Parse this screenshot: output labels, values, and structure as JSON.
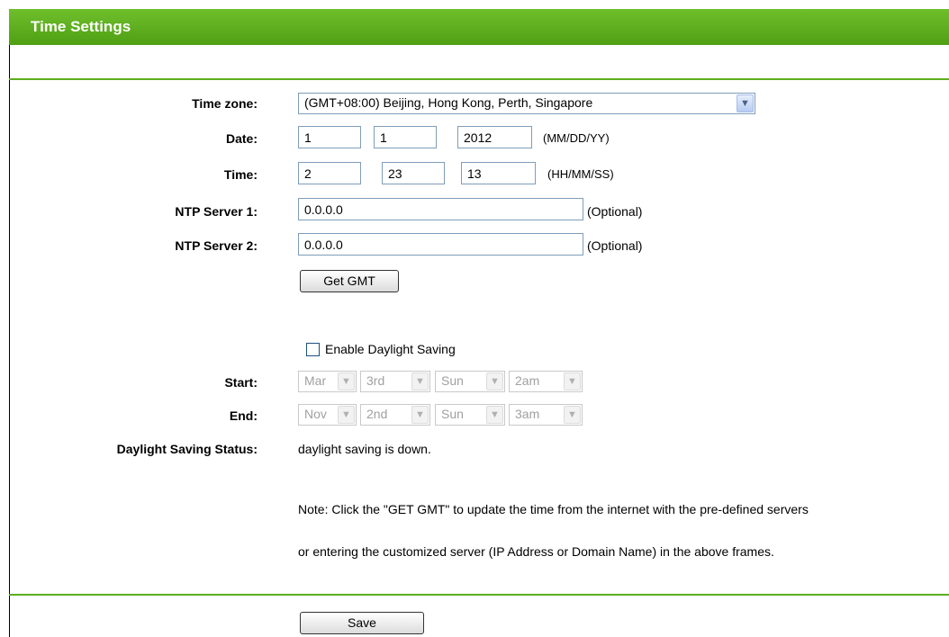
{
  "header": {
    "title": "Time Settings"
  },
  "time_zone": {
    "label": "Time zone:",
    "value": "(GMT+08:00) Beijing, Hong Kong, Perth, Singapore"
  },
  "date": {
    "label": "Date:",
    "month": "1",
    "day": "1",
    "year": "2012",
    "format": "(MM/DD/YY)"
  },
  "time": {
    "label": "Time:",
    "hour": "2",
    "minute": "23",
    "second": "13",
    "format": "(HH/MM/SS)"
  },
  "ntp1": {
    "label": "NTP Server 1:",
    "value": "0.0.0.0",
    "hint": "(Optional)"
  },
  "ntp2": {
    "label": "NTP Server 2:",
    "value": "0.0.0.0",
    "hint": "(Optional)"
  },
  "get_gmt_button": "Get GMT",
  "daylight": {
    "checkbox_label": "Enable Daylight Saving",
    "checked": false
  },
  "start": {
    "label": "Start:",
    "month": "Mar",
    "week": "3rd",
    "day": "Sun",
    "hour": "2am"
  },
  "end": {
    "label": "End:",
    "month": "Nov",
    "week": "2nd",
    "day": "Sun",
    "hour": "3am"
  },
  "status": {
    "label": "Daylight Saving Status:",
    "value": "daylight saving is down."
  },
  "note": {
    "line1": "Note: Click the \"GET GMT\" to update the time from the internet with the pre-defined servers",
    "line2": "or entering the customized server (IP Address or Domain Name) in the above frames."
  },
  "save_button": "Save",
  "colors": {
    "accent": "#5caf1d"
  }
}
